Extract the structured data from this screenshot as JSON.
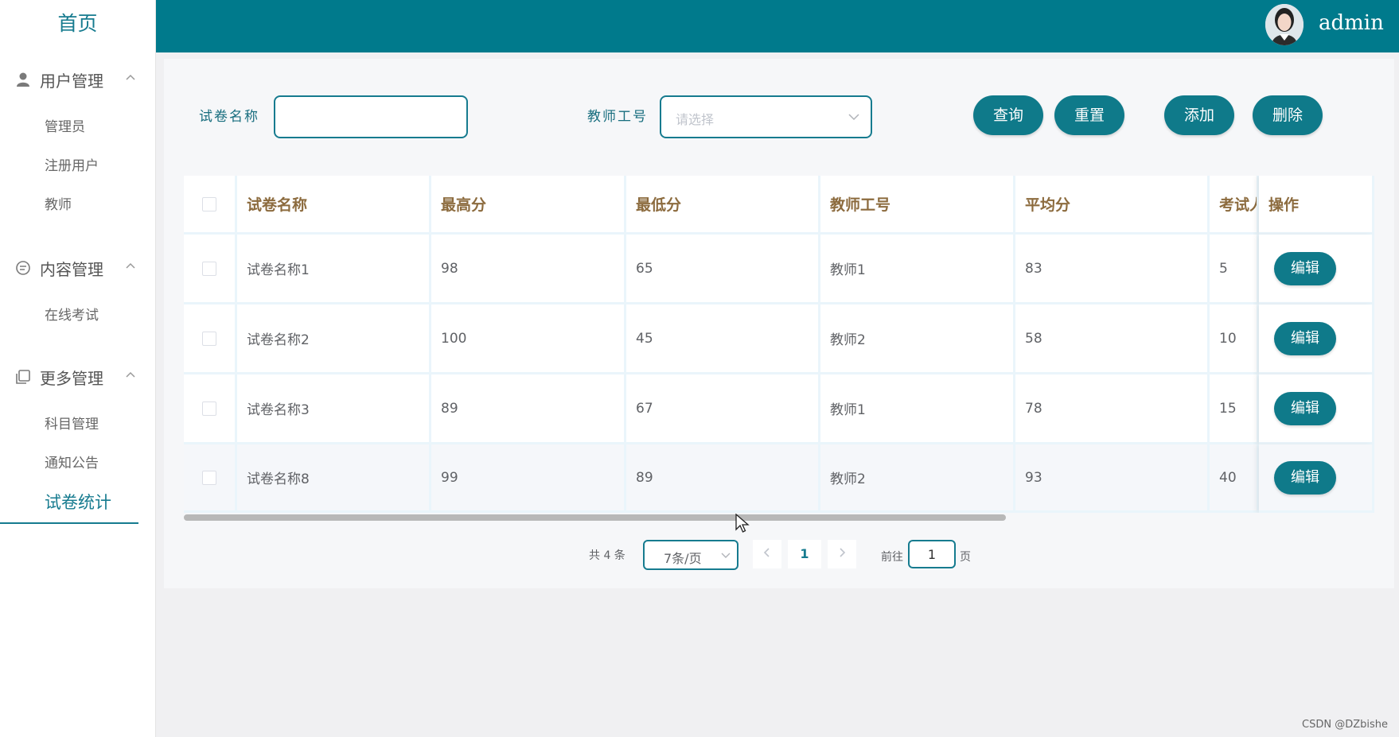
{
  "sidebar": {
    "home": "首页",
    "groups": [
      {
        "label": "用户管理",
        "icon": "user-icon",
        "items": [
          "管理员",
          "注册用户",
          "教师"
        ]
      },
      {
        "label": "内容管理",
        "icon": "chat-icon",
        "items": [
          "在线考试"
        ]
      },
      {
        "label": "更多管理",
        "icon": "copy-icon",
        "items": [
          "科目管理",
          "通知公告",
          "试卷统计"
        ]
      }
    ],
    "active_item": "试卷统计"
  },
  "header": {
    "username": "admin",
    "avatar_icon": "avatar-icon"
  },
  "search": {
    "paper_name_label": "试卷名称",
    "paper_name_value": "",
    "teacher_id_label": "教师工号",
    "teacher_id_placeholder": "请选择"
  },
  "toolbar": {
    "query": "查询",
    "reset": "重置",
    "add": "添加",
    "delete": "删除"
  },
  "table": {
    "columns": [
      "试卷名称",
      "最高分",
      "最低分",
      "教师工号",
      "平均分",
      "考试人",
      "操作"
    ],
    "rows": [
      {
        "name": "试卷名称1",
        "max": "98",
        "min": "65",
        "teacher": "教师1",
        "avg": "83",
        "count": "5",
        "action": "编辑"
      },
      {
        "name": "试卷名称2",
        "max": "100",
        "min": "45",
        "teacher": "教师2",
        "avg": "58",
        "count": "10",
        "action": "编辑"
      },
      {
        "name": "试卷名称3",
        "max": "89",
        "min": "67",
        "teacher": "教师1",
        "avg": "78",
        "count": "15",
        "action": "编辑"
      },
      {
        "name": "试卷名称8",
        "max": "99",
        "min": "89",
        "teacher": "教师2",
        "avg": "93",
        "count": "40",
        "action": "编辑"
      }
    ]
  },
  "pagination": {
    "total_text": "共 4 条",
    "page_size": "7条/页",
    "current_page": "1",
    "goto_label": "前往",
    "goto_value": "1",
    "page_suffix": "页"
  },
  "watermark": "CSDN @DZbishe",
  "colors": {
    "primary": "#0f7a8a",
    "header": "#007a8c",
    "label": "#176d7e",
    "column_header": "#8c6b3e"
  }
}
